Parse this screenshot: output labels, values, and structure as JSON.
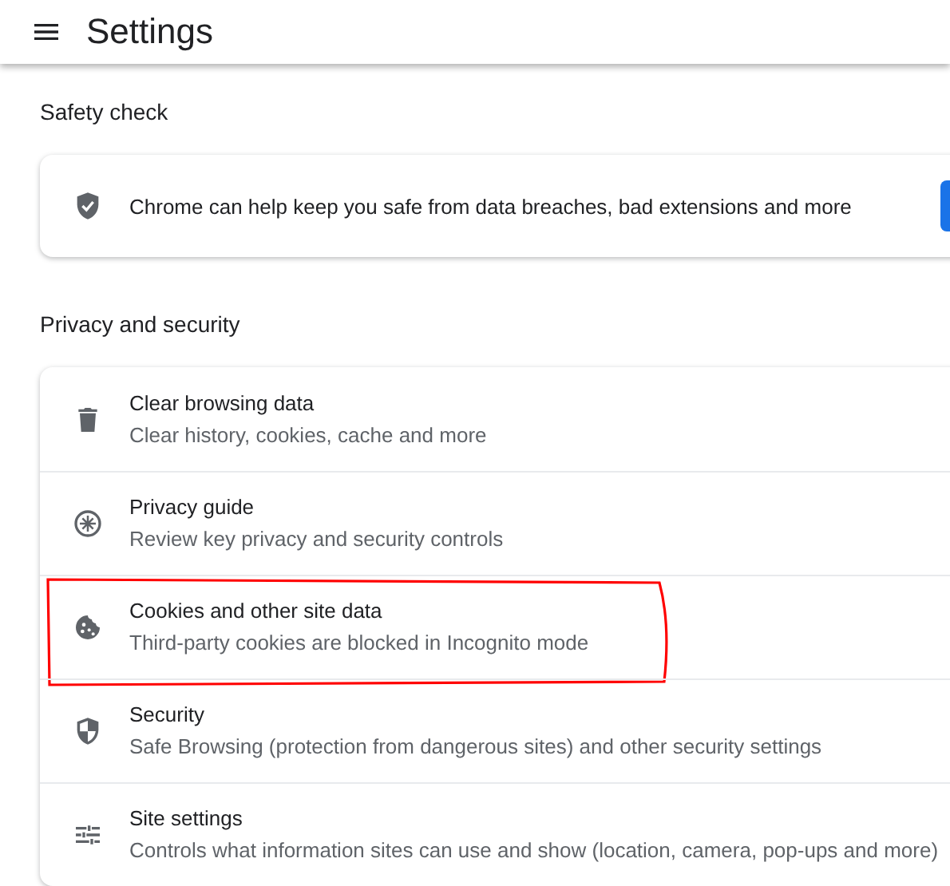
{
  "header": {
    "title": "Settings"
  },
  "sections": [
    {
      "heading": "Safety check",
      "kind": "safety",
      "text": "Chrome can help keep you safe from data breaches, bad extensions and more"
    },
    {
      "heading": "Privacy and security",
      "kind": "list",
      "items": [
        {
          "kind": "trash",
          "title": "Clear browsing data",
          "subtitle": "Clear history, cookies, cache and more",
          "highlighted": false
        },
        {
          "kind": "compass",
          "title": "Privacy guide",
          "subtitle": "Review key privacy and security controls",
          "highlighted": false
        },
        {
          "kind": "cookie",
          "title": "Cookies and other site data",
          "subtitle": "Third-party cookies are blocked in Incognito mode",
          "highlighted": true
        },
        {
          "kind": "shield",
          "title": "Security",
          "subtitle": "Safe Browsing (protection from dangerous sites) and other security settings",
          "highlighted": false
        },
        {
          "kind": "sliders",
          "title": "Site settings",
          "subtitle": "Controls what information sites can use and show (location, camera, pop-ups and more)",
          "highlighted": false
        }
      ]
    }
  ]
}
